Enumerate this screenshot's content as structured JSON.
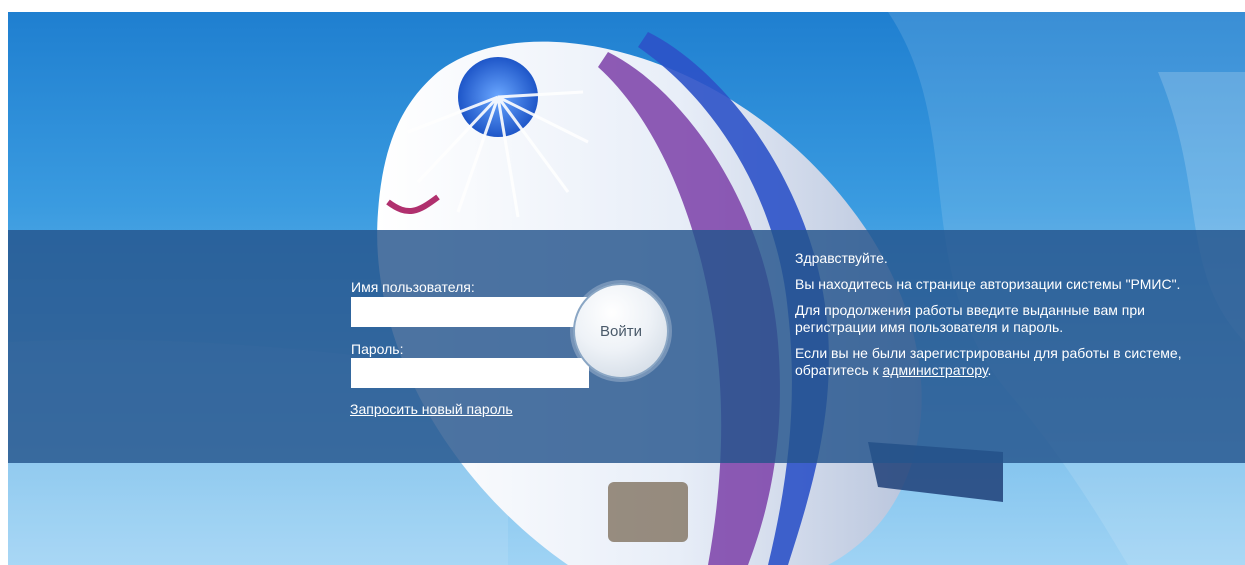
{
  "login_form": {
    "username_label": "Имя пользователя:",
    "username_value": "",
    "password_label": "Пароль:",
    "password_value": "",
    "submit_label": "Войти",
    "reset_link": "Запросить новый пароль"
  },
  "info": {
    "greeting": "Здравствуйте.",
    "line1": "Вы находитесь на странице авторизации системы \"РМИС\".",
    "line2": "Для продолжения работы введите выданные вам при регистрации имя пользователя и пароль.",
    "line3_prefix": "Если вы не были зарегистрированы для работы в системе, обратитесь к ",
    "line3_link": "администратору",
    "line3_suffix": "."
  },
  "colors": {
    "band": "#24548c",
    "sky": "#3a9be0",
    "button_border": "#8aa6c4"
  }
}
